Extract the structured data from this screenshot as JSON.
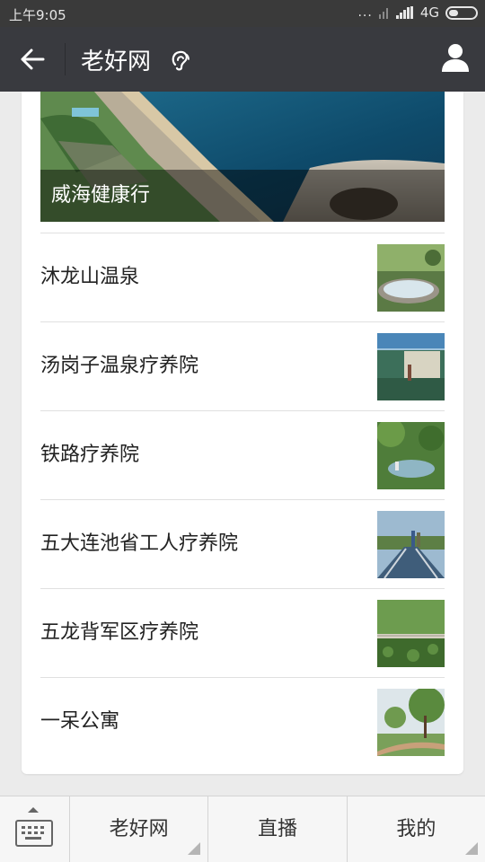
{
  "status_bar": {
    "time": "上午9:05",
    "dots": "...",
    "network": "4G"
  },
  "header": {
    "title": "老好网",
    "icons": [
      "back-arrow-icon",
      "ear-icon",
      "user-icon"
    ]
  },
  "hero": {
    "caption": "威海健康行"
  },
  "list": {
    "items": [
      {
        "label": "沐龙山温泉",
        "thumb": "hot-spring-pool"
      },
      {
        "label": "汤岗子温泉疗养院",
        "thumb": "indoor-spa"
      },
      {
        "label": "铁路疗养院",
        "thumb": "garden-pool"
      },
      {
        "label": "五大连池省工人疗养院",
        "thumb": "bridge-walkway"
      },
      {
        "label": "五龙背军区疗养院",
        "thumb": "lotus-pond"
      },
      {
        "label": "一呆公寓",
        "thumb": "tree-path"
      }
    ]
  },
  "bottom_bar": {
    "tabs": [
      {
        "label": "老好网"
      },
      {
        "label": "直播"
      },
      {
        "label": "我的"
      }
    ]
  },
  "colors": {
    "titlebar": "#393a3f",
    "statusbar": "#3a3a3a",
    "background": "#ebebeb"
  }
}
